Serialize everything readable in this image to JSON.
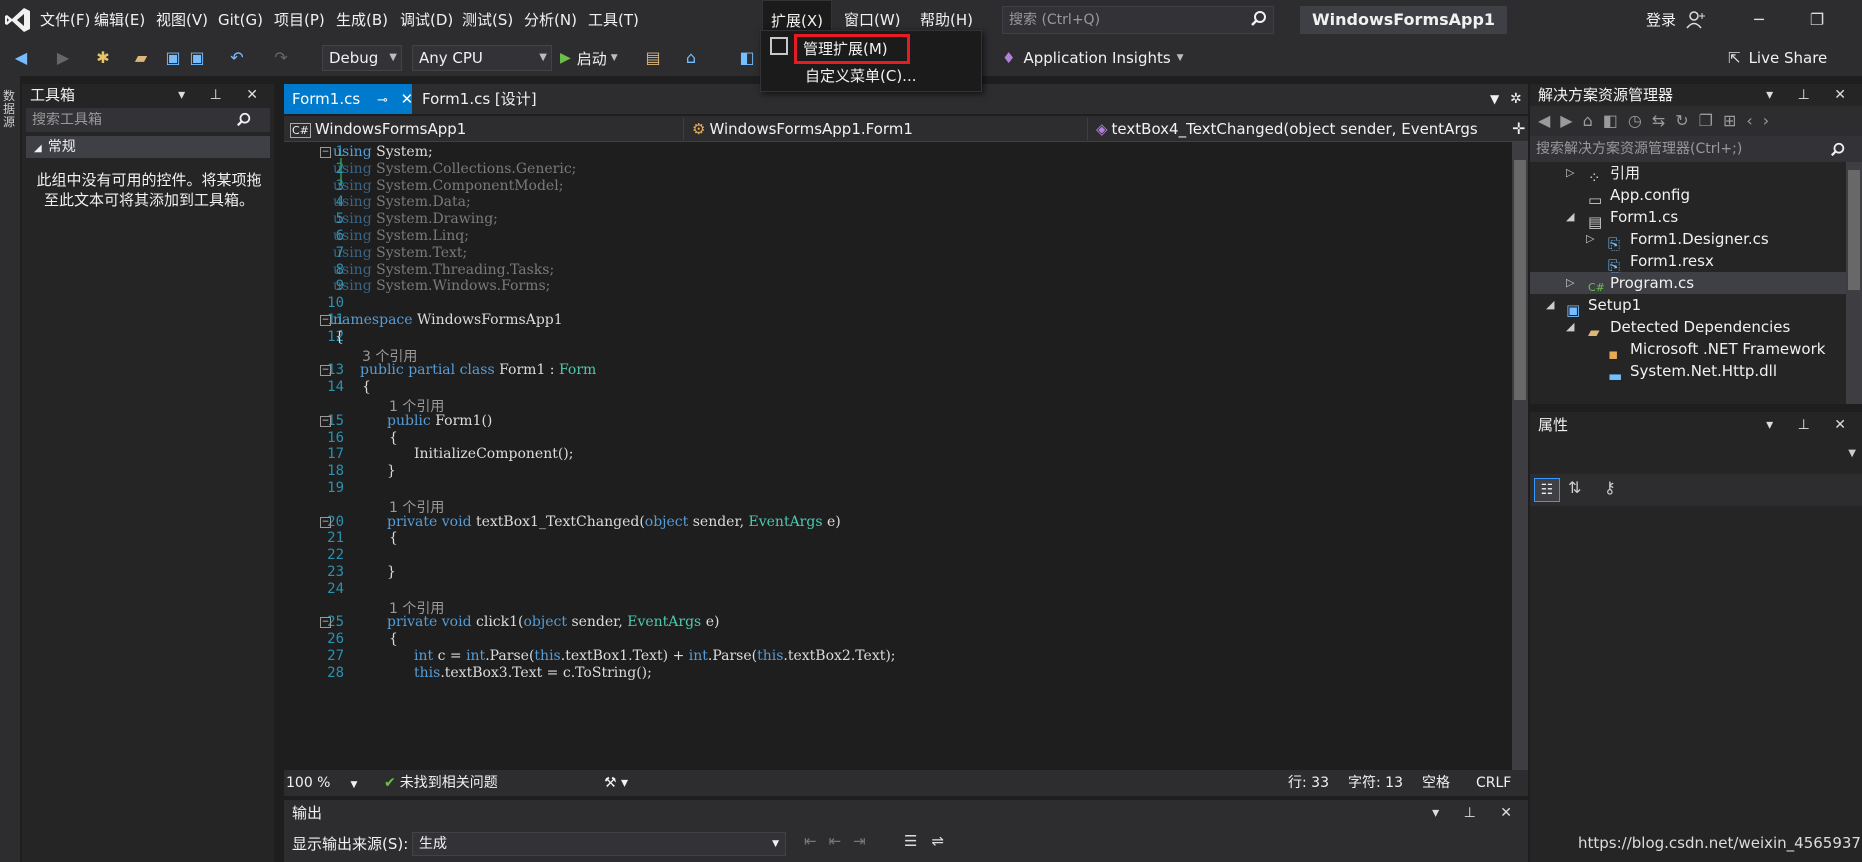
{
  "menubar": {
    "items": [
      "文件(F)",
      "编辑(E)",
      "视图(V)",
      "Git(G)",
      "项目(P)",
      "生成(B)",
      "调试(D)",
      "测试(S)",
      "分析(N)",
      "工具(T)",
      "扩展(X)",
      "窗口(W)",
      "帮助(H)"
    ],
    "search_placeholder": "搜索 (Ctrl+Q)",
    "solution_title": "WindowsFormsApp1",
    "login": "登录",
    "live_share": "Live Share"
  },
  "toolbar": {
    "config": "Debug",
    "platform": "Any CPU",
    "start": "启动",
    "app_insights": "Application Insights"
  },
  "ext_menu": {
    "manage": "管理扩展(M)",
    "customize": "自定义菜单(C)..."
  },
  "side_strip": "数据源",
  "toolbox": {
    "title": "工具箱",
    "search_placeholder": "搜索工具箱",
    "group": "常规",
    "empty_text": "此组中没有可用的控件。将某项拖至此文本可将其添加到工具箱。"
  },
  "editor": {
    "tabs": [
      "Form1.cs",
      "Form1.cs [设计]"
    ],
    "nav": [
      "WindowsFormsApp1",
      "WindowsFormsApp1.Form1",
      "textBox4_TextChanged(object sender, EventArgs"
    ],
    "zoom": "100 %",
    "issues": "未找到相关问题",
    "line": "行: 33",
    "col": "字符: 13",
    "indent": "空格",
    "eol": "CRLF"
  },
  "code_lines": [
    {
      "n": "1",
      "t": "using System;"
    },
    {
      "n": "2",
      "t": "using System.Collections.Generic;"
    },
    {
      "n": "3",
      "t": "using System.ComponentModel;"
    },
    {
      "n": "4",
      "t": "using System.Data;"
    },
    {
      "n": "5",
      "t": "using System.Drawing;"
    },
    {
      "n": "6",
      "t": "using System.Linq;"
    },
    {
      "n": "7",
      "t": "using System.Text;"
    },
    {
      "n": "8",
      "t": "using System.Threading.Tasks;"
    },
    {
      "n": "9",
      "t": "using System.Windows.Forms;"
    },
    {
      "n": "10",
      "t": ""
    },
    {
      "n": "11",
      "t": "namespace WindowsFormsApp1"
    },
    {
      "n": "12",
      "t": "{"
    },
    {
      "n": "13",
      "t": "public partial class Form1 : Form"
    },
    {
      "n": "14",
      "t": "{"
    },
    {
      "n": "15",
      "t": "public Form1()"
    },
    {
      "n": "16",
      "t": "{"
    },
    {
      "n": "17",
      "t": "InitializeComponent();"
    },
    {
      "n": "18",
      "t": "}"
    },
    {
      "n": "19",
      "t": ""
    },
    {
      "n": "20",
      "t": "private void textBox1_TextChanged(object sender, EventArgs e)"
    },
    {
      "n": "21",
      "t": "{"
    },
    {
      "n": "22",
      "t": ""
    },
    {
      "n": "23",
      "t": "}"
    },
    {
      "n": "24",
      "t": ""
    },
    {
      "n": "25",
      "t": "private void click1(object sender, EventArgs e)"
    },
    {
      "n": "26",
      "t": "{"
    },
    {
      "n": "27",
      "t": "int c = int.Parse(this.textBox1.Text) + int.Parse(this.textBox2.Text);"
    },
    {
      "n": "28",
      "t": "this.textBox3.Text = c.ToString();"
    }
  ],
  "code_refs": [
    "3 个引用",
    "1 个引用",
    "1 个引用",
    "1 个引用"
  ],
  "output": {
    "title": "输出",
    "source_label": "显示输出来源(S):",
    "source_value": "生成"
  },
  "solution_explorer": {
    "title": "解决方案资源管理器",
    "search_placeholder": "搜索解决方案资源管理器(Ctrl+;)",
    "items": [
      "引用",
      "App.config",
      "Form1.cs",
      "Form1.Designer.cs",
      "Form1.resx",
      "Program.cs",
      "Setup1",
      "Detected Dependencies",
      "Microsoft .NET Framework",
      "System.Net.Http.dll"
    ]
  },
  "properties": {
    "title": "属性"
  },
  "watermark": "https://blog.csdn.net/weixin_45659376",
  "colors": {
    "accent": "#007acc",
    "highlight_box": "#e51c23",
    "keyword": "#569cd6",
    "type": "#4ec9b0"
  }
}
